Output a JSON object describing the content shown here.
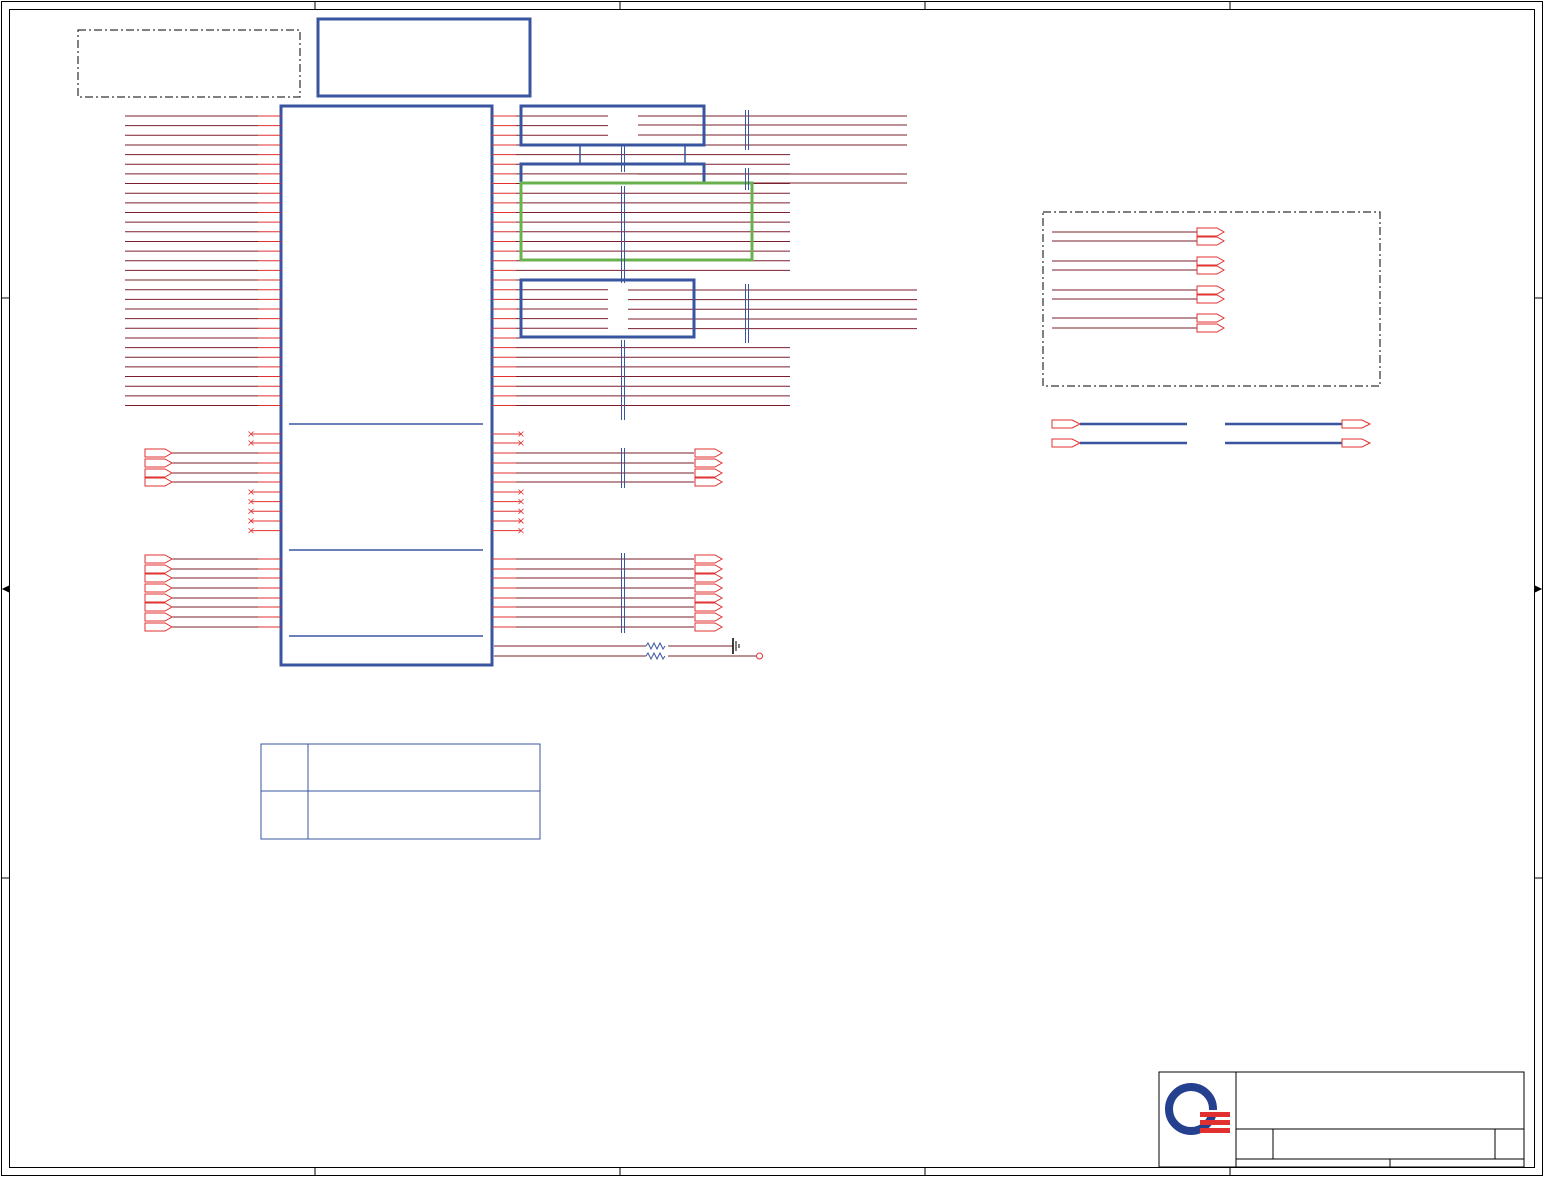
{
  "sheet": {
    "colors": {
      "frame": "#000000",
      "wire": "#7a1f2b",
      "pin": "#e03030",
      "component": "#3a55a0",
      "highlight_box": "#6ab04c",
      "port": "#e03030",
      "logo_blue": "#25408f",
      "logo_red": "#e03030"
    },
    "labels": {},
    "title_block": {
      "logo": "company-logo-icon"
    }
  }
}
